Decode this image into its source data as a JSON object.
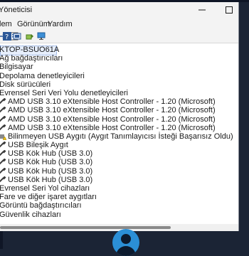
{
  "window": {
    "title": "Yöneticisi",
    "controls": [
      "minimize-icon",
      "maximize-icon"
    ]
  },
  "menubar": {
    "items": [
      "lem",
      "Görünüm",
      "Yardım"
    ]
  },
  "toolbar": {
    "icons": [
      "forward-arrow-icon",
      "properties-icon",
      "help-icon",
      "update-driver-icon",
      "scan-hardware-icon",
      "monitor-icon"
    ]
  },
  "tree": {
    "root": "KTOP-BSUO61A",
    "rows": [
      {
        "label": "Ağ bağdaştırıcıları",
        "icon": "network-adapter-icon",
        "level": 0
      },
      {
        "label": "Bilgisayar",
        "icon": "computer-icon",
        "level": 0
      },
      {
        "label": "Depolama denetleyicileri",
        "icon": "storage-controller-icon",
        "level": 0
      },
      {
        "label": "Disk sürücüleri",
        "icon": "disk-drive-icon",
        "level": 0
      },
      {
        "label": "Evrensel Seri Veri Yolu denetleyicileri",
        "icon": "usb-controller-icon",
        "level": 0
      },
      {
        "label": "AMD USB 3.10 eXtensible Host Controller - 1.20 (Microsoft)",
        "icon": "usb-plug-icon",
        "level": 1
      },
      {
        "label": "AMD USB 3.10 eXtensible Host Controller - 1.20 (Microsoft)",
        "icon": "usb-plug-icon",
        "level": 1
      },
      {
        "label": "AMD USB 3.10 eXtensible Host Controller - 1.20 (Microsoft)",
        "icon": "usb-plug-icon",
        "level": 1
      },
      {
        "label": "AMD USB 3.10 eXtensible Host Controller - 1.20 (Microsoft)",
        "icon": "usb-plug-icon",
        "level": 1
      },
      {
        "label": "Bilinmeyen USB Aygıtı (Aygıt Tanımlayıcısı İsteği Başarısız Oldu)",
        "icon": "warning-device-icon",
        "level": 1
      },
      {
        "label": "USB Bileşik Aygıt",
        "icon": "usb-plug-icon",
        "level": 1
      },
      {
        "label": "USB Kök Hub (USB 3.0)",
        "icon": "usb-plug-icon",
        "level": 1
      },
      {
        "label": "USB Kök Hub (USB 3.0)",
        "icon": "usb-plug-icon",
        "level": 1
      },
      {
        "label": "USB Kök Hub (USB 3.0)",
        "icon": "usb-plug-icon",
        "level": 1
      },
      {
        "label": "USB Kök Hub (USB 3.0)",
        "icon": "usb-plug-icon",
        "level": 1
      },
      {
        "label": "Evrensel Seri Yol cihazları",
        "icon": "usb-device-icon",
        "level": 0
      },
      {
        "label": "Fare ve diğer işaret aygıtları",
        "icon": "mouse-icon",
        "level": 0
      },
      {
        "label": "Görüntü bağdaştırıcıları",
        "icon": "display-adapter-icon",
        "level": 0
      },
      {
        "label": "Güvenlik cihazları",
        "icon": "security-device-icon",
        "level": 0
      }
    ]
  },
  "colors": {
    "accent": "#2b8fd6",
    "desktop": "#1b2435",
    "selection": "#e6eefc",
    "warning": "#f2c200"
  }
}
